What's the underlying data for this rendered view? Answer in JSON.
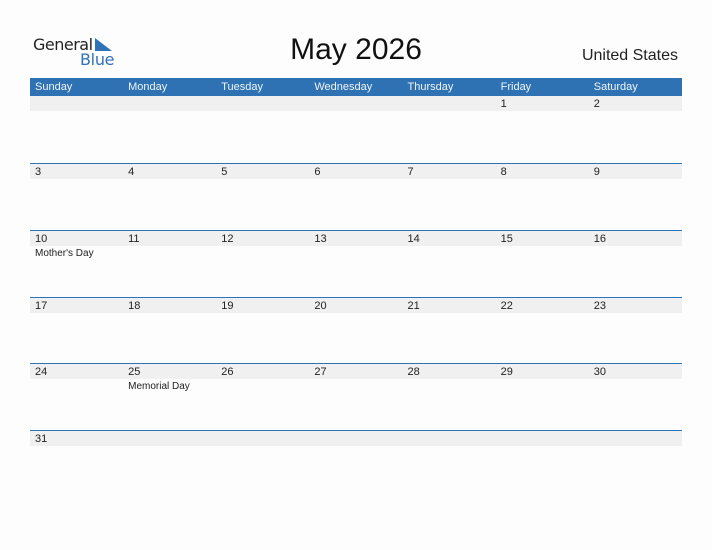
{
  "logo": {
    "word1": "General",
    "word2": "Blue",
    "brand_color": "#2f72b5"
  },
  "title": "May 2026",
  "country": "United States",
  "header_color": "#2e72b3",
  "days": [
    "Sunday",
    "Monday",
    "Tuesday",
    "Wednesday",
    "Thursday",
    "Friday",
    "Saturday"
  ],
  "weeks": [
    [
      {
        "n": ""
      },
      {
        "n": ""
      },
      {
        "n": ""
      },
      {
        "n": ""
      },
      {
        "n": ""
      },
      {
        "n": "1"
      },
      {
        "n": "2"
      }
    ],
    [
      {
        "n": "3"
      },
      {
        "n": "4"
      },
      {
        "n": "5"
      },
      {
        "n": "6"
      },
      {
        "n": "7"
      },
      {
        "n": "8"
      },
      {
        "n": "9"
      }
    ],
    [
      {
        "n": "10",
        "h": "Mother's Day"
      },
      {
        "n": "11"
      },
      {
        "n": "12"
      },
      {
        "n": "13"
      },
      {
        "n": "14"
      },
      {
        "n": "15"
      },
      {
        "n": "16"
      }
    ],
    [
      {
        "n": "17"
      },
      {
        "n": "18"
      },
      {
        "n": "19"
      },
      {
        "n": "20"
      },
      {
        "n": "21"
      },
      {
        "n": "22"
      },
      {
        "n": "23"
      }
    ],
    [
      {
        "n": "24"
      },
      {
        "n": "25",
        "h": "Memorial Day"
      },
      {
        "n": "26"
      },
      {
        "n": "27"
      },
      {
        "n": "28"
      },
      {
        "n": "29"
      },
      {
        "n": "30"
      }
    ],
    [
      {
        "n": "31"
      },
      {
        "n": ""
      },
      {
        "n": ""
      },
      {
        "n": ""
      },
      {
        "n": ""
      },
      {
        "n": ""
      },
      {
        "n": ""
      }
    ]
  ]
}
